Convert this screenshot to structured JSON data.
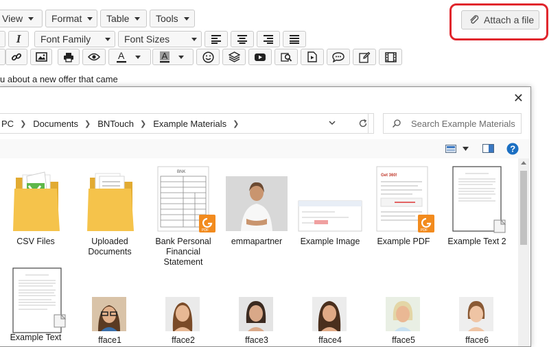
{
  "menubar": {
    "view": "View",
    "format": "Format",
    "table": "Table",
    "tools": "Tools"
  },
  "attach": {
    "label": "Attach a file"
  },
  "toolbar": {
    "font_family": "Font Family",
    "font_sizes": "Font Sizes",
    "italic": "I"
  },
  "editor": {
    "content": "u about a new offer that came"
  },
  "dialog": {
    "breadcrumb": [
      "PC",
      "Documents",
      "BNTouch",
      "Example Materials"
    ],
    "search_placeholder": "Search Example Materials"
  },
  "files": [
    {
      "name": "CSV Files",
      "type": "folder"
    },
    {
      "name": "Uploaded Documents",
      "type": "folder"
    },
    {
      "name": "Bank Personal Financial Statement",
      "type": "pdf"
    },
    {
      "name": "emmapartner",
      "type": "image"
    },
    {
      "name": "Example Image",
      "type": "image"
    },
    {
      "name": "Example PDF",
      "type": "pdf"
    },
    {
      "name": "Example Text 2",
      "type": "text"
    },
    {
      "name": "Example Text",
      "type": "text"
    },
    {
      "name": "fface1",
      "type": "image"
    },
    {
      "name": "fface2",
      "type": "image"
    },
    {
      "name": "fface3",
      "type": "image"
    },
    {
      "name": "fface4",
      "type": "image"
    },
    {
      "name": "fface5",
      "type": "image"
    },
    {
      "name": "fface6",
      "type": "image"
    }
  ],
  "colors": {
    "highlight": "#e0252c",
    "pdf_badge": "#f28b1e",
    "folder": "#f5c34b",
    "accent": "#1b6fc2"
  }
}
